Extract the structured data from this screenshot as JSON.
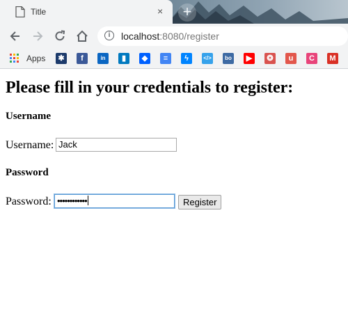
{
  "browser": {
    "tab_title": "Title",
    "tab_close": "×",
    "new_tab": "+",
    "url_host": "localhost",
    "url_path": ":8080/register",
    "apps_label": "Apps"
  },
  "bookmarks": [
    {
      "name": "atlassian-bookmark",
      "color": "#1c3a6b",
      "glyph": "✱"
    },
    {
      "name": "facebook-bookmark",
      "color": "#3b5998",
      "glyph": "f"
    },
    {
      "name": "linkedin-bookmark",
      "color": "#0a66c2",
      "glyph": "in"
    },
    {
      "name": "trello-bookmark",
      "color": "#0079bf",
      "glyph": "▮"
    },
    {
      "name": "dropbox-bookmark",
      "color": "#0061ff",
      "glyph": "◆"
    },
    {
      "name": "docs-bookmark",
      "color": "#4285f4",
      "glyph": "≡"
    },
    {
      "name": "messenger-bookmark",
      "color": "#0084ff",
      "glyph": "ϟ"
    },
    {
      "name": "code-bookmark",
      "color": "#36a2eb",
      "glyph": "</>"
    },
    {
      "name": "bo-bookmark",
      "color": "#3d6aa3",
      "glyph": "bo"
    },
    {
      "name": "youtube-bookmark",
      "color": "#ff0000",
      "glyph": "▶"
    },
    {
      "name": "openai-bookmark",
      "color": "#d9534f",
      "glyph": "❂"
    },
    {
      "name": "u-bookmark",
      "color": "#e2574c",
      "glyph": "u"
    },
    {
      "name": "c-bookmark",
      "color": "#e8447a",
      "glyph": "C"
    },
    {
      "name": "gmail-bookmark",
      "color": "#d93025",
      "glyph": "M"
    }
  ],
  "page": {
    "heading": "Please fill in your credentials to register:",
    "username_section": "Username",
    "username_label": "Username:",
    "username_value": "Jack",
    "password_section": "Password",
    "password_label": "Password:",
    "password_value": "••••••••••••",
    "register_button": "Register"
  }
}
